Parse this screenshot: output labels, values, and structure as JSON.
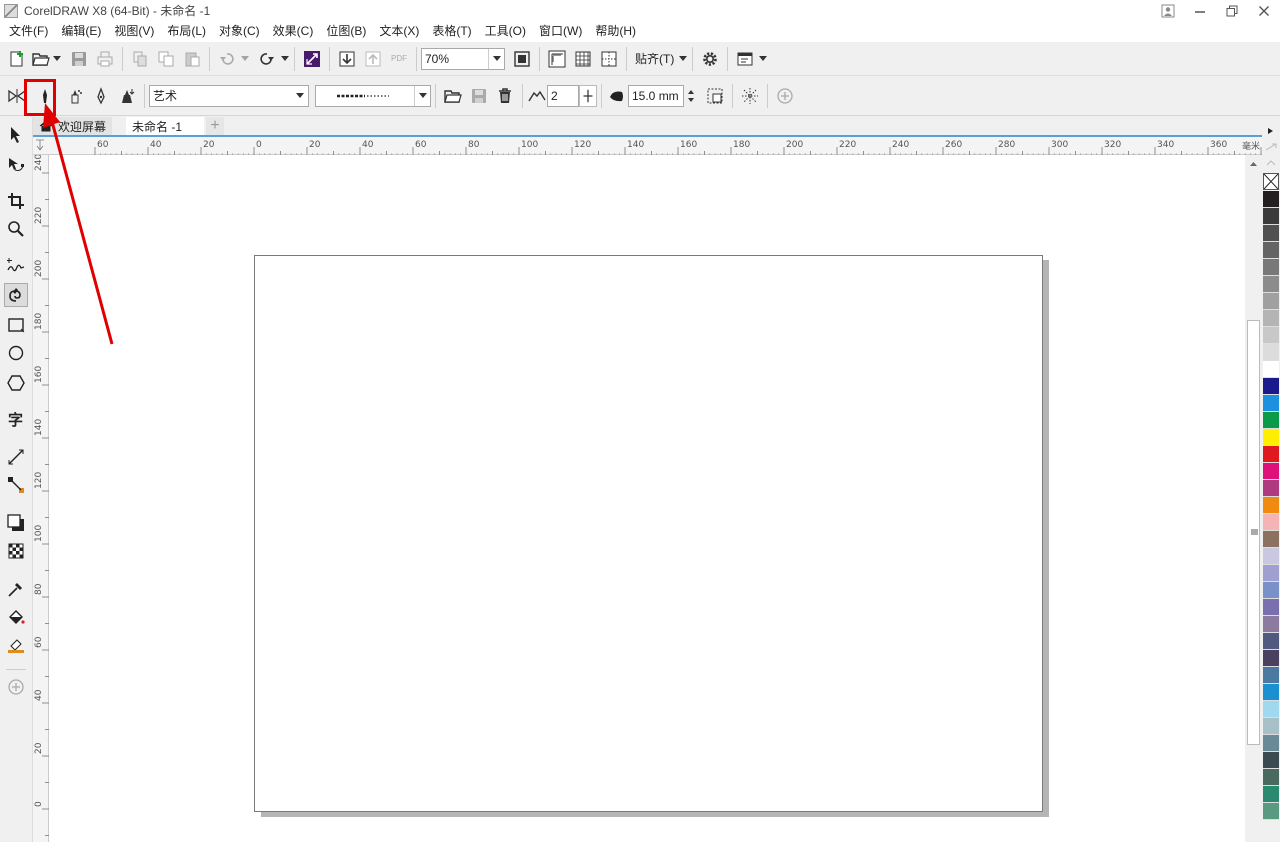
{
  "window": {
    "title": "CorelDRAW X8 (64-Bit) - 未命名 -1",
    "controls": [
      "minimize",
      "restore",
      "close"
    ]
  },
  "menubar": {
    "items": [
      "文件(F)",
      "编辑(E)",
      "视图(V)",
      "布局(L)",
      "对象(C)",
      "效果(C)",
      "位图(B)",
      "文本(X)",
      "表格(T)",
      "工具(O)",
      "窗口(W)",
      "帮助(H)"
    ]
  },
  "toolbar": {
    "zoom_value": "70%",
    "snap_label": "贴齐(T)",
    "pdf_label": "PDF"
  },
  "propbar": {
    "preset_value": "艺术",
    "stroke_count": "2",
    "width_value": "15.0 mm"
  },
  "tabs": {
    "welcome": "欢迎屏幕",
    "document": "未命名 -1"
  },
  "ruler": {
    "unit": "毫米",
    "h_labels": [
      "60",
      "40",
      "20",
      "0",
      "20",
      "40",
      "60",
      "80",
      "100",
      "120",
      "140",
      "160",
      "180",
      "200",
      "220",
      "240",
      "260",
      "280",
      "300",
      "320",
      "340",
      "360"
    ],
    "v_labels": [
      "240",
      "220",
      "200",
      "180",
      "160",
      "140",
      "120",
      "100",
      "80",
      "60",
      "40",
      "20",
      "0"
    ]
  },
  "palette": {
    "colors": [
      "#231f20",
      "#3b3b3b",
      "#505050",
      "#646464",
      "#787878",
      "#8c8c8c",
      "#a0a0a0",
      "#b4b4b4",
      "#c8c8c8",
      "#dcdcdc",
      "#ffffff",
      "#1a1a8c",
      "#1e90e0",
      "#0a9a48",
      "#ffee00",
      "#e01820",
      "#e0107a",
      "#b03a80",
      "#f08a10",
      "#f4b4b4",
      "#8c7060",
      "#c8c8e0",
      "#a0a0d0",
      "#7a90c8",
      "#7a70b0",
      "#8c7aa0",
      "#505a80",
      "#4a4060",
      "#4a7aa0",
      "#1a90d0",
      "#a0d8f0",
      "#a8c0c8",
      "#6a8a98",
      "#3a4a50",
      "#4a6a60",
      "#2a8a70",
      "#5a9a80"
    ]
  }
}
